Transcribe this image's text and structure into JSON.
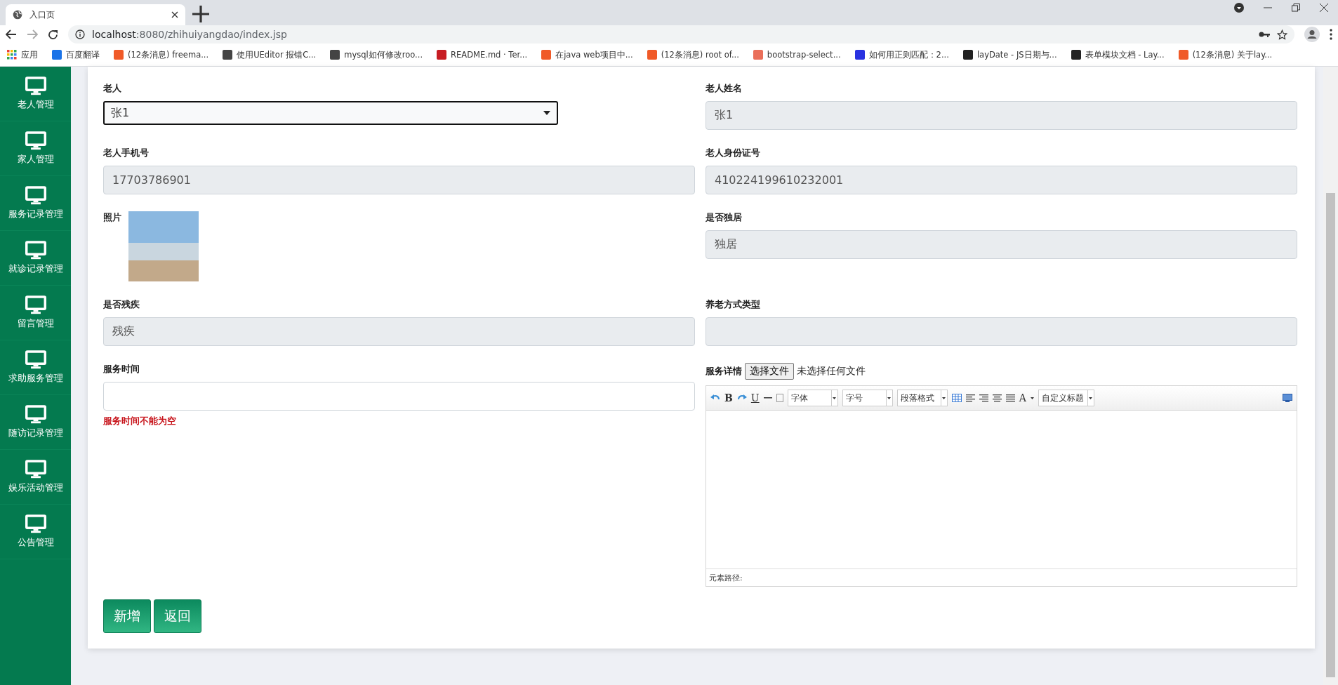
{
  "browser": {
    "tab_title": "入口页",
    "url_host": "localhost",
    "url_path": ":8080/zhihuiyangdao/index.jsp",
    "bookmarks": [
      "应用",
      "百度翻译",
      "(12条消息) freema...",
      "使用UEditor 报错C...",
      "mysql如何修改roo...",
      "README.md · Ter...",
      "在java web项目中...",
      "(12条消息) root of...",
      "bootstrap-select...",
      "如何用正则匹配：2...",
      "layDate - JS日期与...",
      "表单模块文档 - Lay...",
      "(12条消息) 关于lay..."
    ]
  },
  "sidebar": {
    "items": [
      "老人管理",
      "家人管理",
      "服务记录管理",
      "就诊记录管理",
      "留言管理",
      "求助服务管理",
      "随访记录管理",
      "娱乐活动管理",
      "公告管理"
    ]
  },
  "form": {
    "fields": [
      {
        "label": "老人",
        "kind": "select",
        "value": "张1"
      },
      {
        "label": "老人姓名",
        "kind": "readonly",
        "value": "张1"
      },
      {
        "label": "老人手机号",
        "kind": "readonly",
        "value": "17703786901"
      },
      {
        "label": "老人身份证号",
        "kind": "readonly",
        "value": "410224199610232001"
      },
      {
        "label": "照片",
        "kind": "photo"
      },
      {
        "label": "是否独居",
        "kind": "readonly",
        "value": "独居"
      },
      {
        "label": "是否残疾",
        "kind": "readonly",
        "value": "残疾"
      },
      {
        "label": "养老方式类型",
        "kind": "readonly"
      },
      {
        "label": "服务时间",
        "kind": "input",
        "error": "服务时间不能为空"
      },
      {
        "label": "服务详情",
        "kind": "editor",
        "file_button": "选择文件",
        "file_status": "未选择任何文件",
        "glyphs": [
          "B",
          "U",
          "A"
        ],
        "selects": [
          "字体",
          "字号",
          "段落格式"
        ],
        "heading_select": "自定义标题",
        "path_label": "元素路径:"
      }
    ],
    "buttons": [
      "新增",
      "返回"
    ]
  }
}
